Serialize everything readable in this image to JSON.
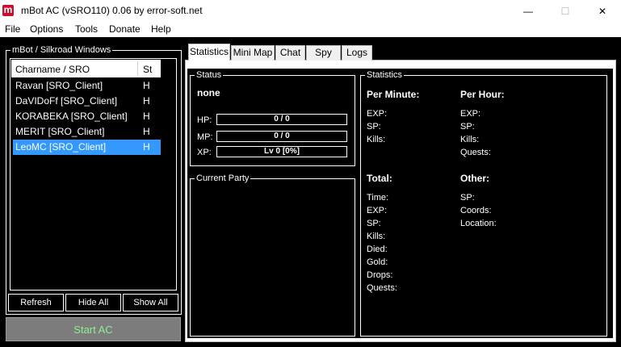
{
  "window": {
    "title": "mBot AC (vSRO110) 0.06 by error-soft.net",
    "icon_letter": "m",
    "minimize_glyph": "—",
    "maximize_glyph": "☐",
    "close_glyph": "✕"
  },
  "menu": [
    "File",
    "Options",
    "Tools",
    "Donate",
    "Help"
  ],
  "sidebar": {
    "group_title": "mBot / Silkroad Windows",
    "columns": [
      "Charname / SRO",
      "St"
    ],
    "rows": [
      {
        "name": "Ravan [SRO_Client]",
        "status": "H"
      },
      {
        "name": "DaVIDoFf [SRO_Client]",
        "status": "H"
      },
      {
        "name": "KORABEKA [SRO_Client]",
        "status": "H"
      },
      {
        "name": "MERIT [SRO_Client]",
        "status": "H"
      },
      {
        "name": "LeoMC [SRO_Client]",
        "status": "H",
        "selected": true
      }
    ],
    "buttons": {
      "refresh": "Refresh",
      "hide_all": "Hide All",
      "show_all": "Show All"
    },
    "start": "Start AC"
  },
  "tabs": [
    "Statistics",
    "Mini Map",
    "Chat",
    "Spy",
    "Logs"
  ],
  "active_tab": "Statistics",
  "status": {
    "title": "Status",
    "name": "none",
    "hp_label": "HP:",
    "hp_value": "0 / 0",
    "mp_label": "MP:",
    "mp_value": "0 / 0",
    "xp_label": "XP:",
    "xp_value": "Lv 0 [0%]"
  },
  "party": {
    "title": "Current Party"
  },
  "statistics": {
    "title": "Statistics",
    "per_minute": {
      "heading": "Per Minute:",
      "items": [
        "EXP:",
        "SP:",
        "Kills:"
      ]
    },
    "per_hour": {
      "heading": "Per Hour:",
      "items": [
        "EXP:",
        "SP:",
        "Kills:",
        "Quests:"
      ]
    },
    "total": {
      "heading": "Total:",
      "items": [
        "Time:",
        "EXP:",
        "SP:",
        "Kills:",
        "Died:",
        "Gold:",
        "Drops:",
        "Quests:"
      ]
    },
    "other": {
      "heading": "Other:",
      "items": [
        "SP:",
        "Coords:",
        "Location:"
      ]
    }
  },
  "colors": {
    "selection": "#3399ff",
    "start_text": "#90ee90",
    "start_bg": "#7c7c7c",
    "icon": "#c8102e"
  }
}
